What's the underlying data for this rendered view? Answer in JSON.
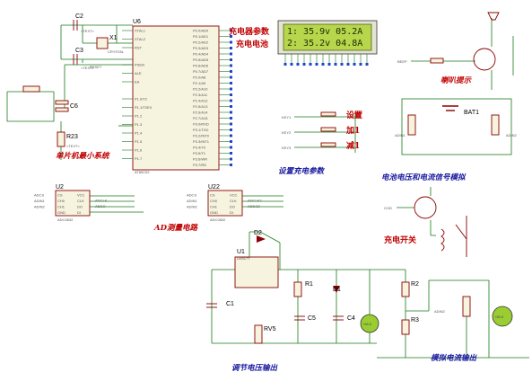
{
  "mcu": {
    "ref": "U6",
    "part": "AT89C52",
    "left_pins": [
      "XTAL1",
      "XTAL2",
      "RST",
      "",
      "PSEN",
      "ALE",
      "EA",
      "",
      "P1.0/T2",
      "P1.1/T2EX",
      "P1.2",
      "P1.3",
      "P1.4",
      "P1.5",
      "P1.6",
      "P1.7"
    ],
    "right_pins": [
      "P0.0/AD0",
      "P0.1/AD1",
      "P0.2/AD2",
      "P0.3/AD3",
      "P0.4/AD4",
      "P0.5/AD5",
      "P0.6/AD6",
      "P0.7/AD7",
      "P2.0/A8",
      "P2.1/A9",
      "P2.2/A10",
      "P2.3/A11",
      "P2.4/A12",
      "P2.5/A13",
      "P2.6/A14",
      "P2.7/A15",
      "P3.0/RXD",
      "P3.1/TXD",
      "P3.2/INT0",
      "P3.3/INT1",
      "P3.4/T0",
      "P3.5/T1",
      "P3.6/WR",
      "P3.7/RD"
    ]
  },
  "components": {
    "c2": "C2",
    "c3": "C3",
    "x1": "X1",
    "crystal": "CRYSTAL",
    "c6": "C6",
    "r23": "R23",
    "reset_label": "RESET",
    "u2": "U2",
    "u22": "U22",
    "adc_part": "ADC0832",
    "r1": "R1",
    "c1": "C1",
    "c5": "C5",
    "c4": "C4",
    "r2": "R2",
    "r3": "R3",
    "d1": "D1",
    "d2": "D2",
    "u1": "U1",
    "u1_part": "LM317T",
    "rv5": "RV5",
    "bat1": "BAT1",
    "text_placeholder": "<TEXT>",
    "voltmeter": "+88.8",
    "ammeter": "+88.8",
    "keys": [
      "KEY1",
      "KEY2",
      "KEY3"
    ],
    "adc_pins_left": [
      "CS",
      "CH0",
      "CH1",
      "GND"
    ],
    "adc_pins_right": [
      "VCC",
      "CLK",
      "DO",
      "DI"
    ],
    "u2_net_left": [
      "ADCS",
      "ADIN1",
      "ADIN2"
    ],
    "u22_net_left": [
      "ADCS",
      "ADIN1",
      "ADIN2"
    ],
    "u2_net_right": [
      "ADCLK",
      "ADDO"
    ],
    "u22_net_right": [
      "ADCLK2",
      "ADDO2"
    ],
    "beep": "BEEP",
    "chg": "CHG",
    "adin_r": [
      "ADIN1",
      "ADIN2"
    ],
    "adin_bottom": "ADIN2"
  },
  "lcd": {
    "line1": "1: 35.9v 05.2A",
    "line2": "2: 35.2v 04.8A"
  },
  "labels": {
    "charge_params": "充电器参数",
    "charge_battery": "充电电池",
    "mcu_min_system": "单片机最小系统",
    "ad_circuit": "AD测量电路",
    "set_params": "设置充电参数",
    "key_set": "设置",
    "key_add": "加1",
    "key_sub": "减1",
    "buzzer": "喇叭提示",
    "battery_sim": "电池电压和电流信号模拟",
    "charge_switch": "充电开关",
    "adjust_output": "调节电压输出",
    "sim_current": "模拟电流输出"
  },
  "colors": {
    "wire": "#1a7a1a",
    "component": "#8b0000",
    "pin": "#2244cc",
    "lcd_bg": "#b7d64b",
    "label_red": "#c00000",
    "label_blue": "#1a1aa0"
  }
}
